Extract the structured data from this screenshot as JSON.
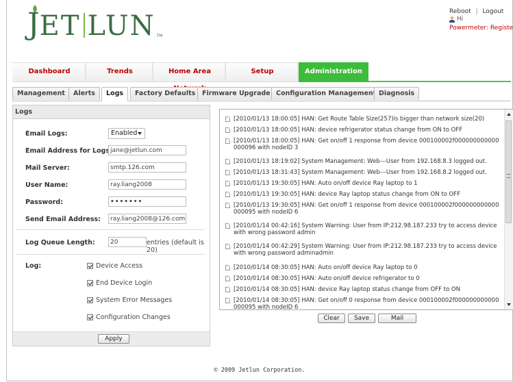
{
  "header": {
    "logo_text": "JET|LUN",
    "logo_tm": "TM",
    "reboot_label": "Reboot",
    "logout_label": "Logout",
    "separator": "|",
    "greeting": "Hi",
    "powermeter_status": "Powermeter: Registere"
  },
  "main_nav": [
    {
      "label": "Dashboard"
    },
    {
      "label": "Trends"
    },
    {
      "label": "Home Area Network"
    },
    {
      "label": "Setup"
    },
    {
      "label": "Administration",
      "active": true
    }
  ],
  "sub_tabs": [
    {
      "label": "Management"
    },
    {
      "label": "Alerts"
    },
    {
      "label": "Logs",
      "active": true
    },
    {
      "label": "Factory Defaults"
    },
    {
      "label": "Firmware Upgrade"
    },
    {
      "label": "Configuration Management"
    },
    {
      "label": "Diagnosis"
    }
  ],
  "logs_panel": {
    "title": "Logs",
    "email_logs_label": "Email Logs:",
    "email_logs_value": "Enabled",
    "email_address_label": "Email Address for Logs:",
    "email_address_value": "jane@jetlun.com",
    "mail_server_label": "Mail Server:",
    "mail_server_value": "smtp.126.com",
    "user_name_label": "User Name:",
    "user_name_value": "ray.liang2008",
    "password_label": "Password:",
    "password_value": "•••••••",
    "send_email_label": "Send Email Address:",
    "send_email_value": "ray.liang2008@126.com",
    "queue_label": "Log Queue Length:",
    "queue_value": "20",
    "queue_hint": "entries (default is 20)",
    "log_label": "Log:",
    "log_options": [
      {
        "label": "Device Access",
        "checked": true
      },
      {
        "label": "End Device Login",
        "checked": true
      },
      {
        "label": "System Error Messages",
        "checked": true
      },
      {
        "label": "Configuration Changes",
        "checked": true
      }
    ],
    "apply_label": "Apply"
  },
  "log_entries": [
    "[2010/01/13 18:00:05] HAN: Get Route Table Size(257)is bigger than network size(20)",
    "[2010/01/13 18:00:05] HAN: device refrigerator status change from ON to OFF",
    "[2010/01/13 18:00:05] HAN: Get on/off 1 response from device 000100002f000000000000000096 with nodeID 3",
    "[2010/01/13 18:19:02] System Management: Web---User from 192.168.8.3 logged out.",
    "[2010/01/13 18:31:43] System Management: Web---User from 192.168.8.2 logged out.",
    "[2010/01/13 19:30:05] HAN: Auto on/off device Ray laptop to 1",
    "[2010/01/13 19:30:05] HAN: device Ray laptop status change from ON to OFF",
    "[2010/01/13 19:30:05] HAN: Get on/off 1 response from device 000100002f000000000000000095 with nodeID 6",
    "[2010/01/14 00:42:16] System Warning: User from IP:212.98.187.233 try to access device with wrong password admin",
    "[2010/01/14 00:42:29] System Warning: User from IP:212.98.187.233 try to access device with wrong password adminadmin",
    "[2010/01/14 08:30:05] HAN: Auto on/off device Ray laptop to 0",
    "[2010/01/14 08:30:05] HAN: Auto on/off device refrigerator to 0",
    "[2010/01/14 08:30:05] HAN: device Ray laptop status change from OFF to ON",
    "[2010/01/14 08:30:05] HAN: Get on/off 0 response from device 000100002f000000000000000095 with nodeID 6"
  ],
  "log_buttons": {
    "clear_label": "Clear",
    "save_label": "Save",
    "mail_label": "Mail"
  },
  "footer": {
    "copyright": "© 2009 Jetlun Corporation."
  },
  "colors": {
    "brand_green": "#3b6e43",
    "active_tab": "#3dbb3a",
    "nav_text": "#bb0000"
  }
}
